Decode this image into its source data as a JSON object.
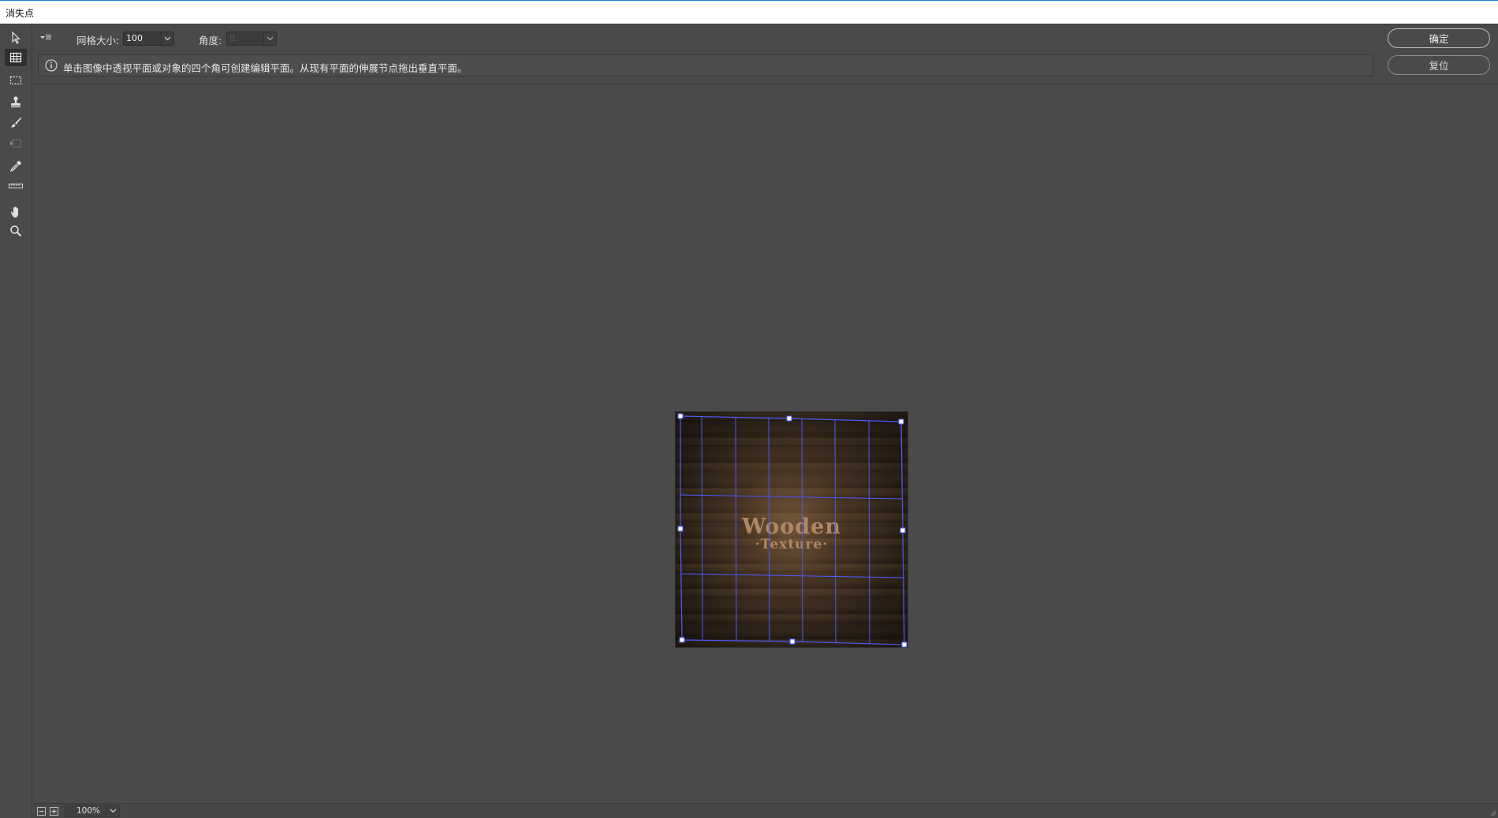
{
  "window": {
    "title": "消失点"
  },
  "tools": [
    {
      "name": "edit-plane-tool",
      "icon": "arrow-pointer-icon"
    },
    {
      "name": "create-plane-tool",
      "icon": "grid-plane-icon",
      "active": true
    },
    {
      "name": "marquee-tool",
      "icon": "marquee-icon"
    },
    {
      "name": "stamp-tool",
      "icon": "stamp-icon"
    },
    {
      "name": "brush-tool",
      "icon": "brush-icon"
    },
    {
      "name": "transform-tool",
      "icon": "transform-icon",
      "disabled": true
    },
    {
      "name": "eyedropper-tool",
      "icon": "eyedropper-icon"
    },
    {
      "name": "measure-tool",
      "icon": "ruler-icon"
    },
    {
      "name": "hand-tool",
      "icon": "hand-icon"
    },
    {
      "name": "zoom-tool",
      "icon": "magnifier-icon"
    }
  ],
  "options": {
    "grid_size_label": "网格大小:",
    "grid_size_value": "100",
    "angle_label": "角度:",
    "angle_value": "0"
  },
  "info": {
    "message": "单击图像中透视平面或对象的四个角可创建编辑平面。从现有平面的伸展节点拖出垂直平面。"
  },
  "buttons": {
    "ok": "确定",
    "reset": "复位"
  },
  "image": {
    "title_line1": "Wooden",
    "title_line2": "·Texture·"
  },
  "status": {
    "zoom_value": "100%"
  },
  "colors": {
    "grid_line": "#4d5cff",
    "background": "#4a4a4a",
    "titlebar_accent": "#1e7bd8"
  }
}
